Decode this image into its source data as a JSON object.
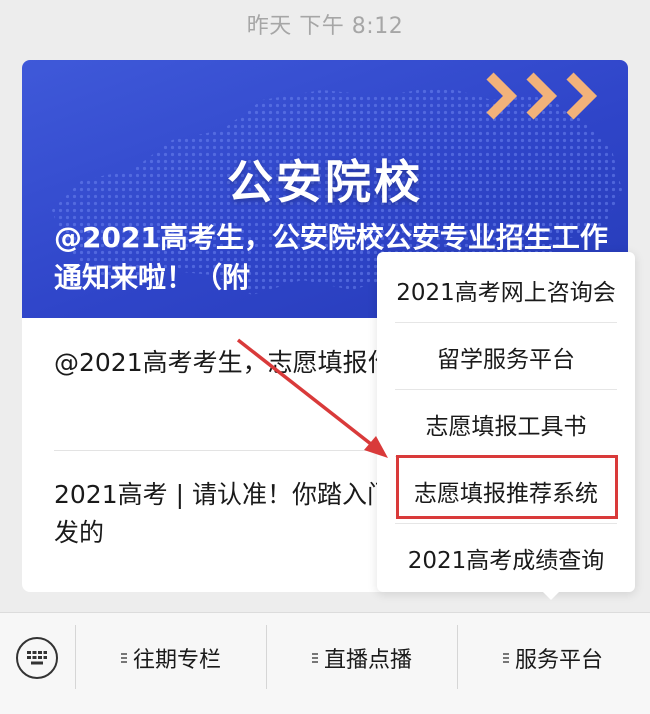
{
  "timestamp": "昨天 下午 8:12",
  "banner": {
    "heading": "公安院校",
    "caption": "@2021高考生，公安院校公安专业招生工作通知来啦！（附",
    "chevron_color": "#f2b27a",
    "background_color": "#3147cc"
  },
  "articles": [
    {
      "title": "@2021高考考生，志愿填报作使用说明来啦！"
    },
    {
      "title": "2021高考 | 请认准！你踏入门的通知书，是他签发的"
    }
  ],
  "service_menu": {
    "items": [
      {
        "label": "2021高考网上咨询会"
      },
      {
        "label": "留学服务平台"
      },
      {
        "label": "志愿填报工具书"
      },
      {
        "label": "志愿填报推荐系统",
        "highlighted": true
      },
      {
        "label": "2021高考成绩查询"
      }
    ],
    "highlight_color": "#d93a3a"
  },
  "bottom_bar": {
    "keyboard_icon": "keyboard-icon",
    "tabs": [
      {
        "label": "往期专栏"
      },
      {
        "label": "直播点播"
      },
      {
        "label": "服务平台"
      }
    ]
  }
}
